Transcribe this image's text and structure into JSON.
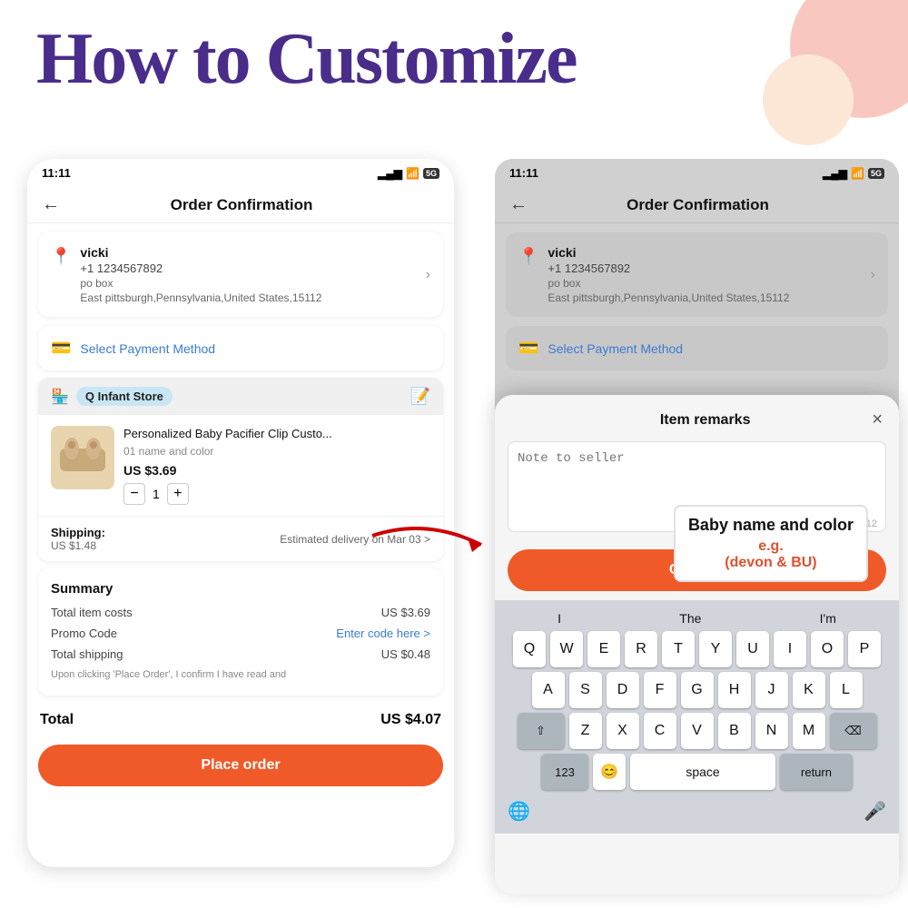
{
  "page": {
    "title": "How to Customize",
    "bg_circle_colors": [
      "#f8c8c0",
      "#fde8d8"
    ]
  },
  "left_phone": {
    "status_bar": {
      "time": "11:11",
      "signal": "▂▄▆",
      "wifi": "wifi",
      "badge": "5G"
    },
    "nav": {
      "back": "←",
      "title": "Order Confirmation"
    },
    "address": {
      "name": "vicki",
      "phone": "+1 1234567892",
      "line1": "po box",
      "line2": "East pittsburgh,Pennsylvania,United States,15112"
    },
    "payment": {
      "label": "Select Payment Method"
    },
    "store": {
      "name": "Q Infant Store"
    },
    "product": {
      "name": "Personalized Baby Pacifier Clip Custo...",
      "variant": "01 name and color",
      "price": "US $3.69",
      "qty": "1"
    },
    "shipping": {
      "label": "Shipping:",
      "cost": "US $1.48",
      "delivery": "Estimated delivery on Mar 03 >"
    },
    "summary": {
      "title": "Summary",
      "item_cost_label": "Total item costs",
      "item_cost_value": "US $3.69",
      "promo_label": "Promo Code",
      "promo_value": "Enter code here >",
      "shipping_label": "Total shipping",
      "shipping_value": "US $0.48",
      "disclaimer": "Upon clicking 'Place Order', I confirm I have read and",
      "total_label": "Total",
      "total_value": "US $4.07"
    },
    "place_order_btn": "Place order"
  },
  "right_phone": {
    "status_bar": {
      "time": "11:11",
      "signal": "▂▄▆",
      "wifi": "wifi",
      "badge": "5G"
    },
    "nav": {
      "back": "←",
      "title": "Order Confirmation"
    },
    "address": {
      "name": "vicki",
      "phone": "+1 1234567892",
      "line1": "po box",
      "line2": "East pittsburgh,Pennsylvania,United States,15112"
    },
    "payment": {
      "label": "Select Payment Method"
    }
  },
  "popup": {
    "title": "Item remarks",
    "close": "×",
    "textarea_placeholder": "Note to seller",
    "char_count": "0/512",
    "annotation_main": "Baby name and color",
    "annotation_eg": "e.g.",
    "annotation_example": "(devon & BU)",
    "confirm_btn": "Confirm"
  },
  "keyboard": {
    "suggestions": [
      "I",
      "The",
      "I'm"
    ],
    "row1": [
      "Q",
      "W",
      "E",
      "R",
      "T",
      "Y",
      "U",
      "I",
      "O",
      "P"
    ],
    "row2": [
      "A",
      "S",
      "D",
      "F",
      "G",
      "H",
      "J",
      "K",
      "L"
    ],
    "row3": [
      "Z",
      "X",
      "C",
      "V",
      "B",
      "N",
      "M"
    ],
    "bottom": {
      "num_label": "123",
      "space_label": "space",
      "return_label": "return"
    }
  }
}
